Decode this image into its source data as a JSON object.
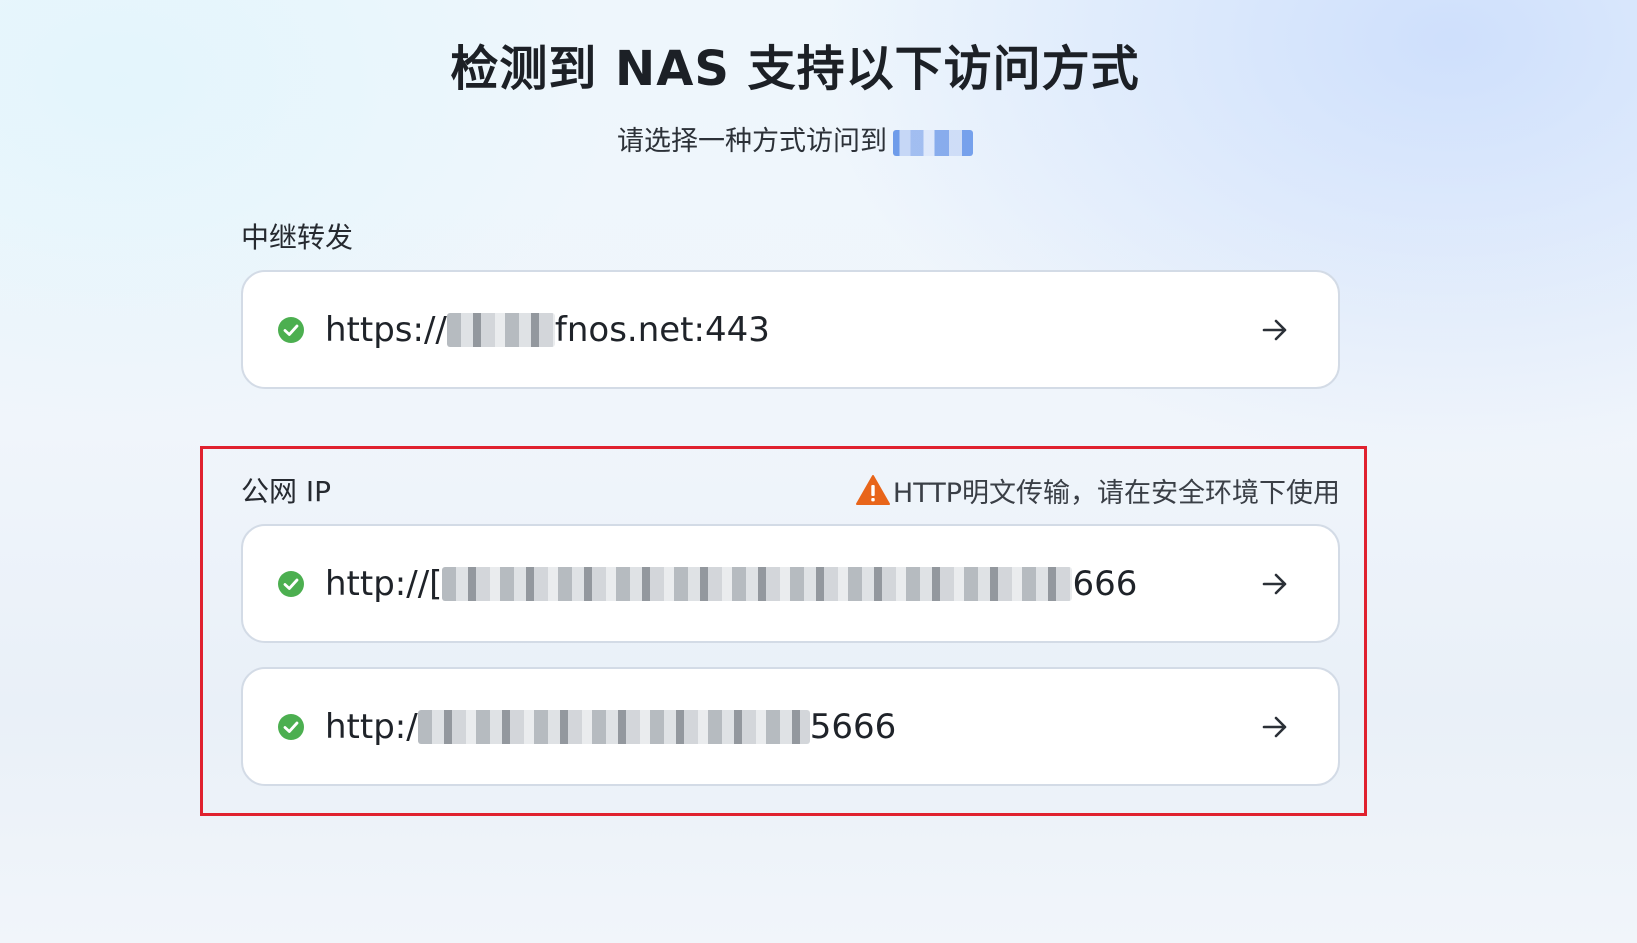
{
  "header": {
    "title": "检测到 NAS 支持以下访问方式",
    "subtitle": "请选择一种方式访问到"
  },
  "relay": {
    "label": "中继转发",
    "urls": [
      {
        "prefix": "https://",
        "suffix": "fnos.net:443",
        "status_icon": "check-circle-icon",
        "action_icon": "arrow-right-icon"
      }
    ]
  },
  "public_ip": {
    "label": "公网 IP",
    "warning_icon": "warning-triangle-icon",
    "warning_text": "HTTP明文传输，请在安全环境下使用",
    "urls": [
      {
        "prefix": "http://[",
        "suffix": "666",
        "status_icon": "check-circle-icon",
        "action_icon": "arrow-right-icon"
      },
      {
        "prefix": "http:/",
        "suffix": "5666",
        "status_icon": "check-circle-icon",
        "action_icon": "arrow-right-icon"
      }
    ]
  },
  "colors": {
    "check": "#4caf50",
    "warning": "#e8651a",
    "highlight_border": "#e0212f",
    "card_border": "#d3dbe6"
  }
}
